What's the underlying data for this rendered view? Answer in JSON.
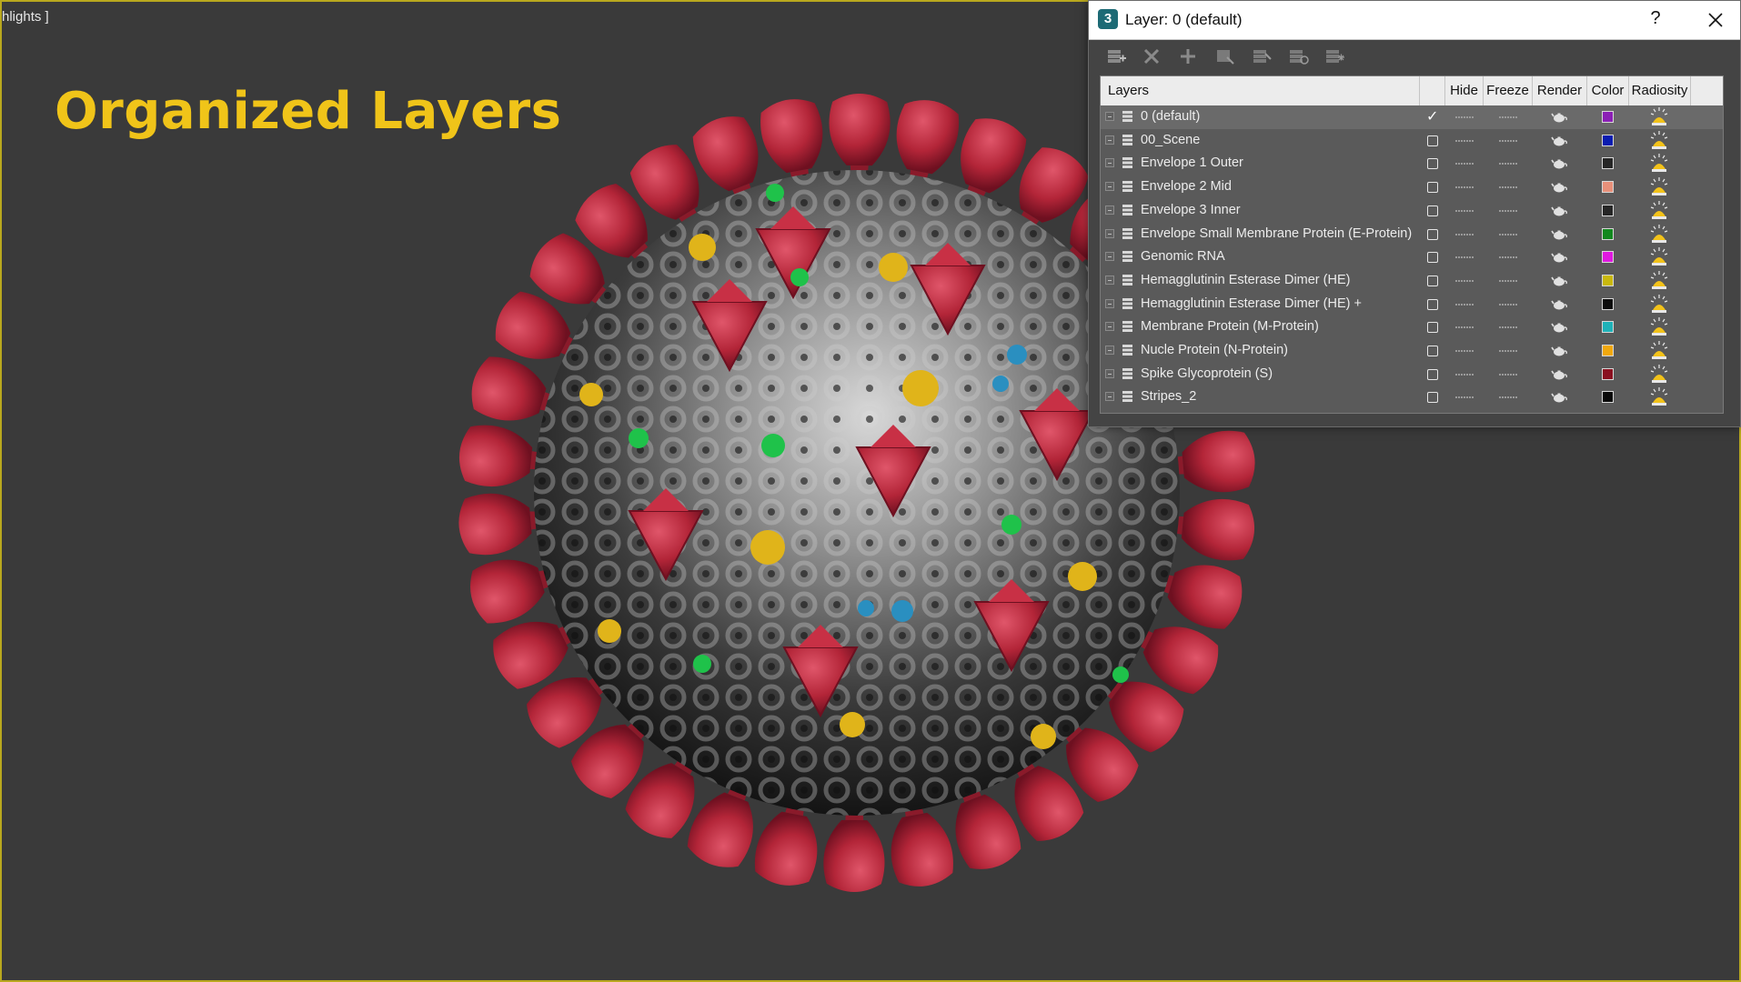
{
  "viewport": {
    "label": "hlights ]",
    "title": "Organized Layers"
  },
  "dialog": {
    "title": "Layer: 0 (default)",
    "help_label": "?",
    "toolbar_icons": [
      "create-layer-icon",
      "delete-layer-icon",
      "add-to-layer-icon",
      "select-in-layer-icon",
      "highlight-selected-icon",
      "hide-all-icon",
      "freeze-all-icon"
    ],
    "columns": {
      "layers": "Layers",
      "hide": "Hide",
      "freeze": "Freeze",
      "render": "Render",
      "color": "Color",
      "radiosity": "Radiosity"
    },
    "layers": [
      {
        "name": "0 (default)",
        "current": true,
        "color": "#8b1fb5"
      },
      {
        "name": "00_Scene",
        "current": false,
        "color": "#0a1cb0"
      },
      {
        "name": "Envelope 1 Outer",
        "current": false,
        "color": "#262626"
      },
      {
        "name": "Envelope 2 Mid",
        "current": false,
        "color": "#e8907a"
      },
      {
        "name": "Envelope 3 Inner",
        "current": false,
        "color": "#262626"
      },
      {
        "name": "Envelope Small Membrane Protein (E-Protein)",
        "current": false,
        "color": "#12881e"
      },
      {
        "name": "Genomic RNA",
        "current": false,
        "color": "#e018e0"
      },
      {
        "name": "Hemagglutinin Esterase Dimer (HE)",
        "current": false,
        "color": "#c9b80e"
      },
      {
        "name": "Hemagglutinin Esterase Dimer (HE) +",
        "current": false,
        "color": "#0c0c0c"
      },
      {
        "name": "Membrane Protein (M-Protein)",
        "current": false,
        "color": "#1fb2b8"
      },
      {
        "name": "Nucle Protein (N-Protein)",
        "current": false,
        "color": "#f0a80e"
      },
      {
        "name": "Spike Glycoprotein (S)",
        "current": false,
        "color": "#8a1020"
      },
      {
        "name": "Stripes_2",
        "current": false,
        "color": "#080808"
      }
    ]
  }
}
